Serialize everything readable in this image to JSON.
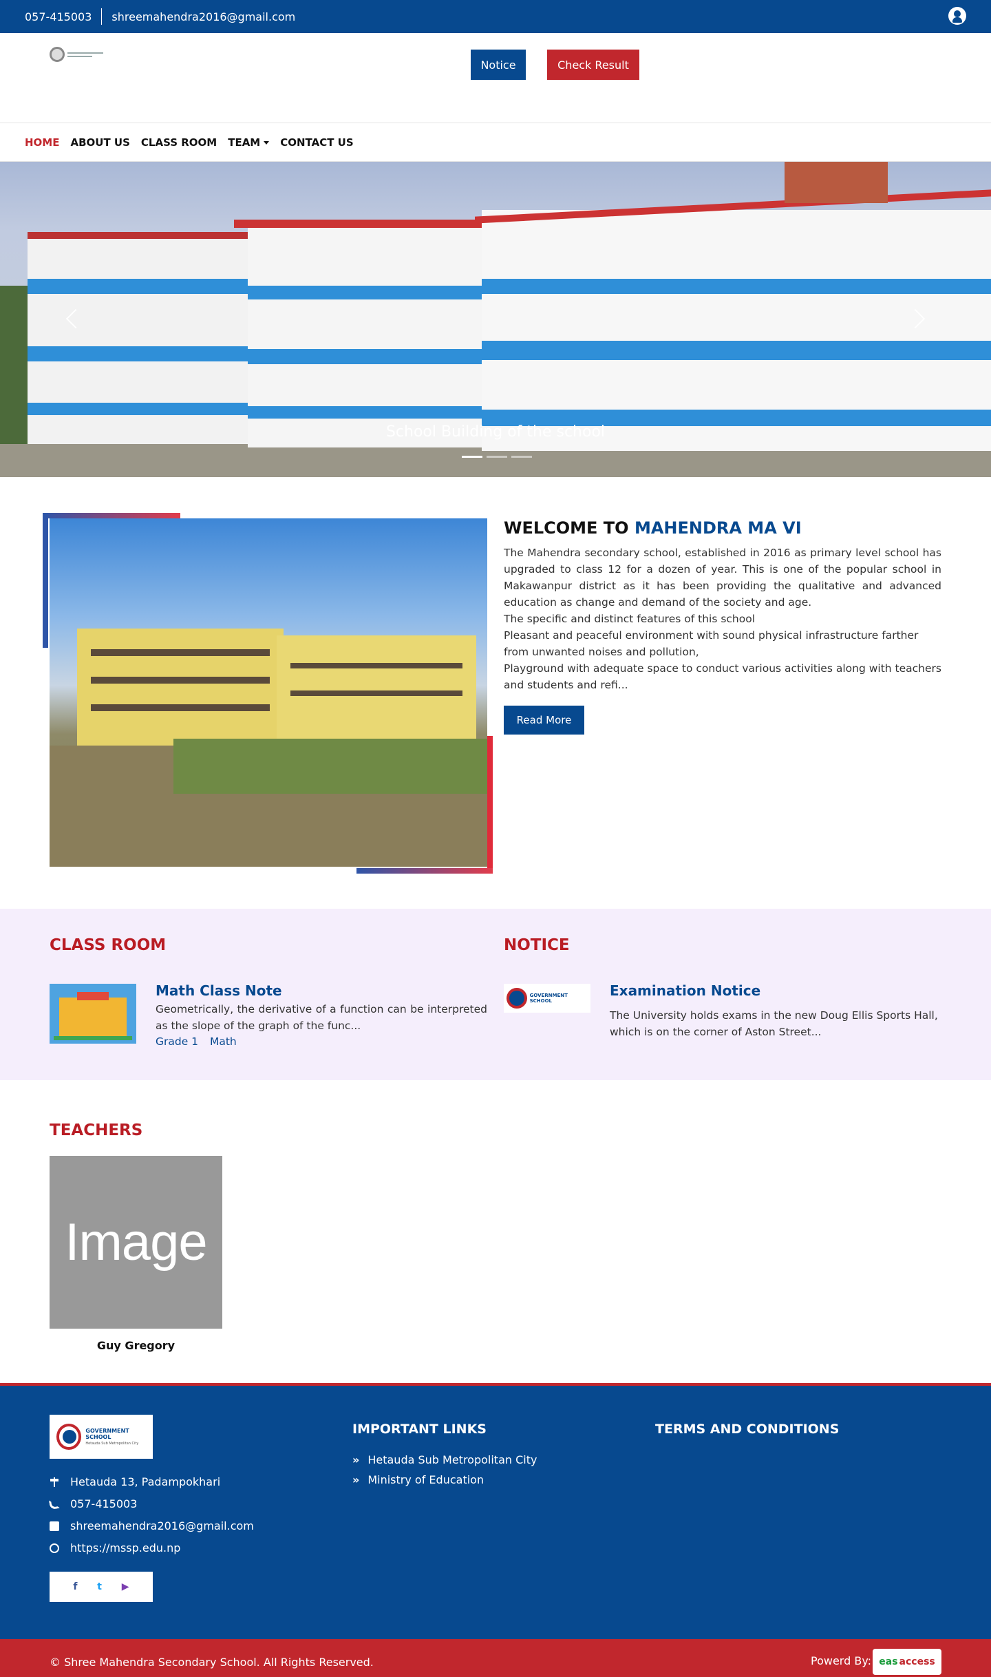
{
  "topbar": {
    "phone": "057-415003",
    "email": "shreemahendra2016@gmail.com"
  },
  "header": {
    "notice_btn": "Notice",
    "result_btn": "Check Result"
  },
  "nav": [
    {
      "label": "HOME"
    },
    {
      "label": "ABOUT US"
    },
    {
      "label": "CLASS ROOM"
    },
    {
      "label": "TEAM"
    },
    {
      "label": "CONTACT US"
    }
  ],
  "hero": {
    "caption": "School Building of the school"
  },
  "welcome": {
    "title_prefix": "WELCOME TO",
    "title_highlight": "MAHENDRA MA VI",
    "para1": "The Mahendra secondary school, established in 2016 as primary level school has upgraded to class 12 for a dozen of year. This is one of the popular school in Makawanpur district as it has been providing the qualitative and advanced education as change and demand of the society and age.",
    "para2": "The specific and distinct features of this school",
    "para3": "Pleasant and peaceful environment with sound physical infrastructure farther from unwanted noises and pollution,",
    "para4": "Playground with adequate space to  conduct various activities along with teachers and students and refi...",
    "read_more": "Read More"
  },
  "classroom": {
    "heading": "CLASS ROOM",
    "item_title": "Math Class Note",
    "item_text": "Geometrically, the derivative of a function can be interpreted as the slope of the graph of the func...",
    "tags": [
      "Grade 1",
      "Math"
    ]
  },
  "notice": {
    "heading": "NOTICE",
    "item_title": "Examination Notice",
    "item_text": "The University holds exams in the new Doug Ellis Sports Hall, which is on the corner of Aston Street..."
  },
  "teachers": {
    "heading": "TEACHERS",
    "placeholder": "Image",
    "name": "Guy Gregory"
  },
  "footer": {
    "logo_title": "GOVERNMENT SCHOOL",
    "logo_sub": "Hetauda Sub Metropolitan City",
    "address": "Hetauda 13, Padampokhari",
    "phone": "057-415003",
    "email": "shreemahendra2016@gmail.com",
    "website": "https://mssp.edu.np",
    "social": [
      "f",
      "t",
      "▶"
    ],
    "links_title": "IMPORTANT LINKS",
    "links": [
      "Hetauda Sub Metropolitan City",
      "Ministry of Education"
    ],
    "terms_title": "TERMS AND CONDITIONS",
    "copyright": "© Shree Mahendra Secondary School. All Rights Reserved.",
    "powered": "Powerd By:",
    "brand_a": "eas",
    "brand_b": "access"
  }
}
